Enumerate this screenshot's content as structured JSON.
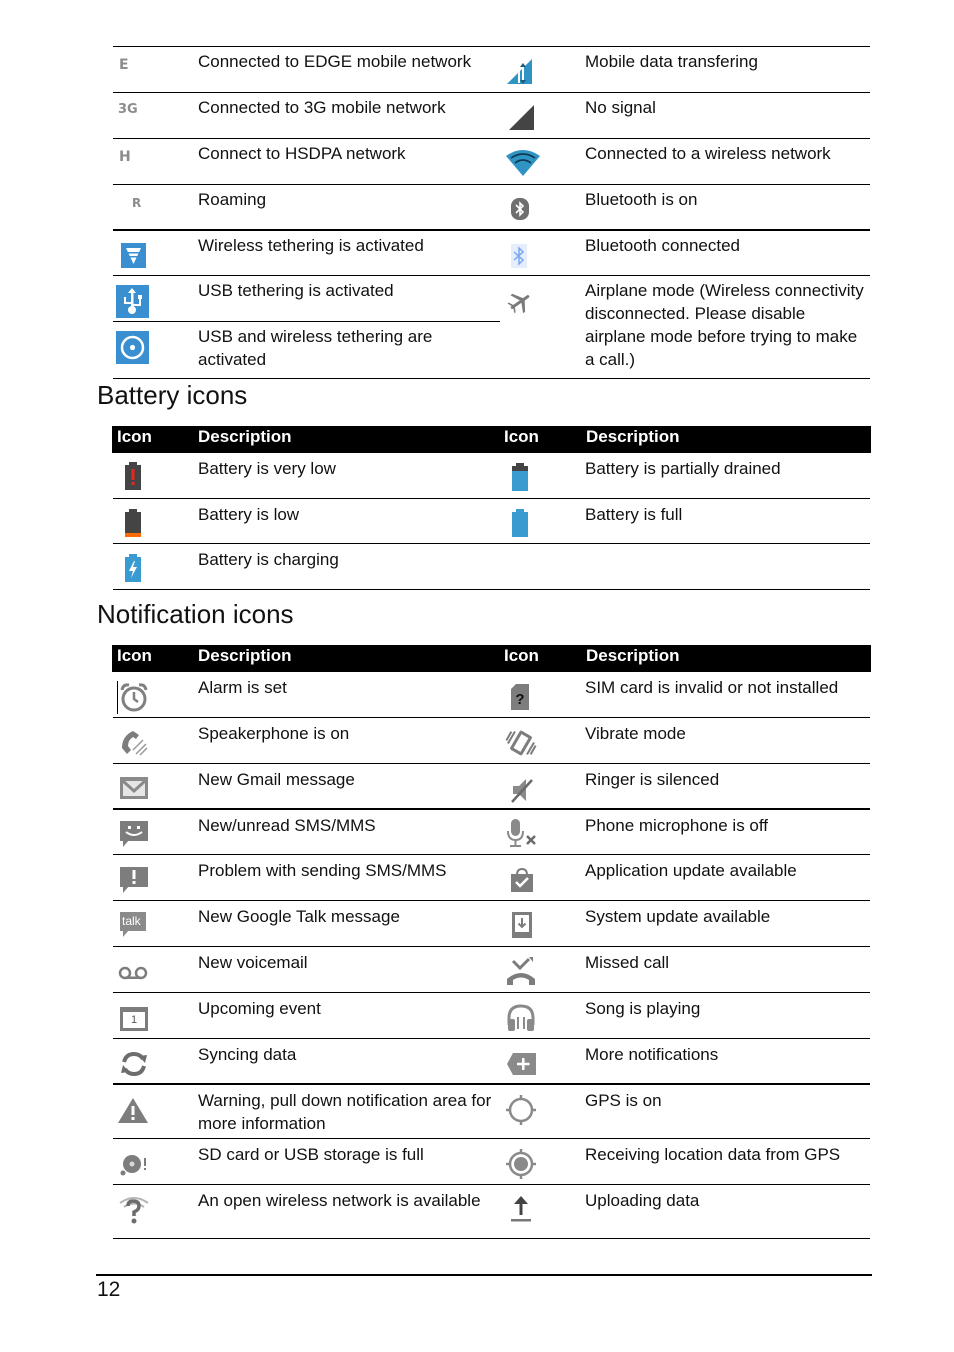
{
  "status_icons": {
    "rows": [
      {
        "left": {
          "icon": "edge-icon",
          "glyph": "E",
          "desc": "Connected to EDGE mobile network"
        },
        "right": {
          "icon": "mobile-data-transfer-icon",
          "desc": "Mobile data transfering"
        }
      },
      {
        "left": {
          "icon": "3g-icon",
          "glyph": "3G",
          "desc": "Connected to 3G mobile network"
        },
        "right": {
          "icon": "no-signal-icon",
          "desc": "No signal"
        }
      },
      {
        "left": {
          "icon": "hsdpa-icon",
          "glyph": "H",
          "desc": "Connect to HSDPA network"
        },
        "right": {
          "icon": "wifi-icon",
          "desc": "Connected to a wireless network"
        }
      },
      {
        "left": {
          "icon": "roaming-icon",
          "glyph": "R",
          "desc": "Roaming"
        },
        "right": {
          "icon": "bluetooth-on-icon",
          "desc": "Bluetooth is on"
        }
      },
      {
        "left": {
          "icon": "wireless-tethering-icon",
          "desc": "Wireless tethering is activated"
        },
        "right": {
          "icon": "bluetooth-connected-icon",
          "desc": "Bluetooth connected"
        }
      },
      {
        "left": {
          "icon": "usb-tethering-icon",
          "desc": "USB tethering is activated"
        },
        "right": {
          "icon": "airplane-icon",
          "desc": "Airplane mode (Wireless connectivity disconnected. Please disable airplane mode before trying to make a call.)"
        }
      },
      {
        "left": {
          "icon": "usb-wireless-tethering-icon",
          "desc": "USB and wireless tethering are activated"
        }
      }
    ]
  },
  "battery": {
    "title": "Battery icons",
    "header": {
      "icon": "Icon",
      "description": "Description"
    },
    "rows": [
      {
        "left": {
          "icon": "battery-very-low-icon",
          "desc": "Battery is very low"
        },
        "right": {
          "icon": "battery-partially-drained-icon",
          "desc": "Battery is partially drained"
        }
      },
      {
        "left": {
          "icon": "battery-low-icon",
          "desc": "Battery is low"
        },
        "right": {
          "icon": "battery-full-icon",
          "desc": "Battery is full"
        }
      },
      {
        "left": {
          "icon": "battery-charging-icon",
          "desc": "Battery is charging"
        },
        "right": {
          "icon": "",
          "desc": ""
        }
      }
    ]
  },
  "notification": {
    "title": "Notification icons",
    "header": {
      "icon": "Icon",
      "description": "Description"
    },
    "rows": [
      {
        "left": {
          "icon": "alarm-icon",
          "desc": "Alarm is set"
        },
        "right": {
          "icon": "sim-invalid-icon",
          "desc": "SIM card is invalid or not installed"
        }
      },
      {
        "left": {
          "icon": "speakerphone-icon",
          "desc": "Speakerphone is on"
        },
        "right": {
          "icon": "vibrate-icon",
          "desc": "Vibrate mode"
        }
      },
      {
        "left": {
          "icon": "gmail-icon",
          "desc": "New Gmail message"
        },
        "right": {
          "icon": "ringer-silenced-icon",
          "desc": "Ringer is silenced"
        }
      },
      {
        "left": {
          "icon": "sms-icon",
          "desc": "New/unread SMS/MMS"
        },
        "right": {
          "icon": "mic-off-icon",
          "desc": "Phone microphone is off"
        }
      },
      {
        "left": {
          "icon": "sms-problem-icon",
          "desc": "Problem with sending SMS/MMS"
        },
        "right": {
          "icon": "app-update-icon",
          "desc": "Application update available"
        }
      },
      {
        "left": {
          "icon": "google-talk-icon",
          "glyph": "talk",
          "desc": "New Google Talk message"
        },
        "right": {
          "icon": "system-update-icon",
          "desc": "System update available"
        }
      },
      {
        "left": {
          "icon": "voicemail-icon",
          "desc": "New voicemail"
        },
        "right": {
          "icon": "missed-call-icon",
          "desc": "Missed call"
        }
      },
      {
        "left": {
          "icon": "calendar-icon",
          "glyph": "1",
          "desc": "Upcoming event"
        },
        "right": {
          "icon": "headphones-icon",
          "desc": "Song is playing"
        }
      },
      {
        "left": {
          "icon": "sync-icon",
          "desc": "Syncing data"
        },
        "right": {
          "icon": "more-notifications-icon",
          "desc": "More notifications"
        }
      },
      {
        "left": {
          "icon": "warning-icon",
          "desc": "Warning, pull down notification area for more information"
        },
        "right": {
          "icon": "gps-on-icon",
          "desc": "GPS is on"
        }
      },
      {
        "left": {
          "icon": "storage-full-icon",
          "desc": "SD card or USB storage is full"
        },
        "right": {
          "icon": "gps-receiving-icon",
          "desc": "Receiving location data from GPS"
        }
      },
      {
        "left": {
          "icon": "open-wifi-icon",
          "desc": "An open wireless network is available"
        },
        "right": {
          "icon": "upload-icon",
          "desc": "Uploading data"
        }
      }
    ]
  },
  "footer": {
    "page_number": "12"
  },
  "colors": {
    "accent_blue": "#3a9bd0",
    "icon_gray": "#8a8a8a",
    "battery_dark": "#4a4a4a",
    "alert_red": "#e8261c",
    "battery_orange": "#ff6a00"
  }
}
